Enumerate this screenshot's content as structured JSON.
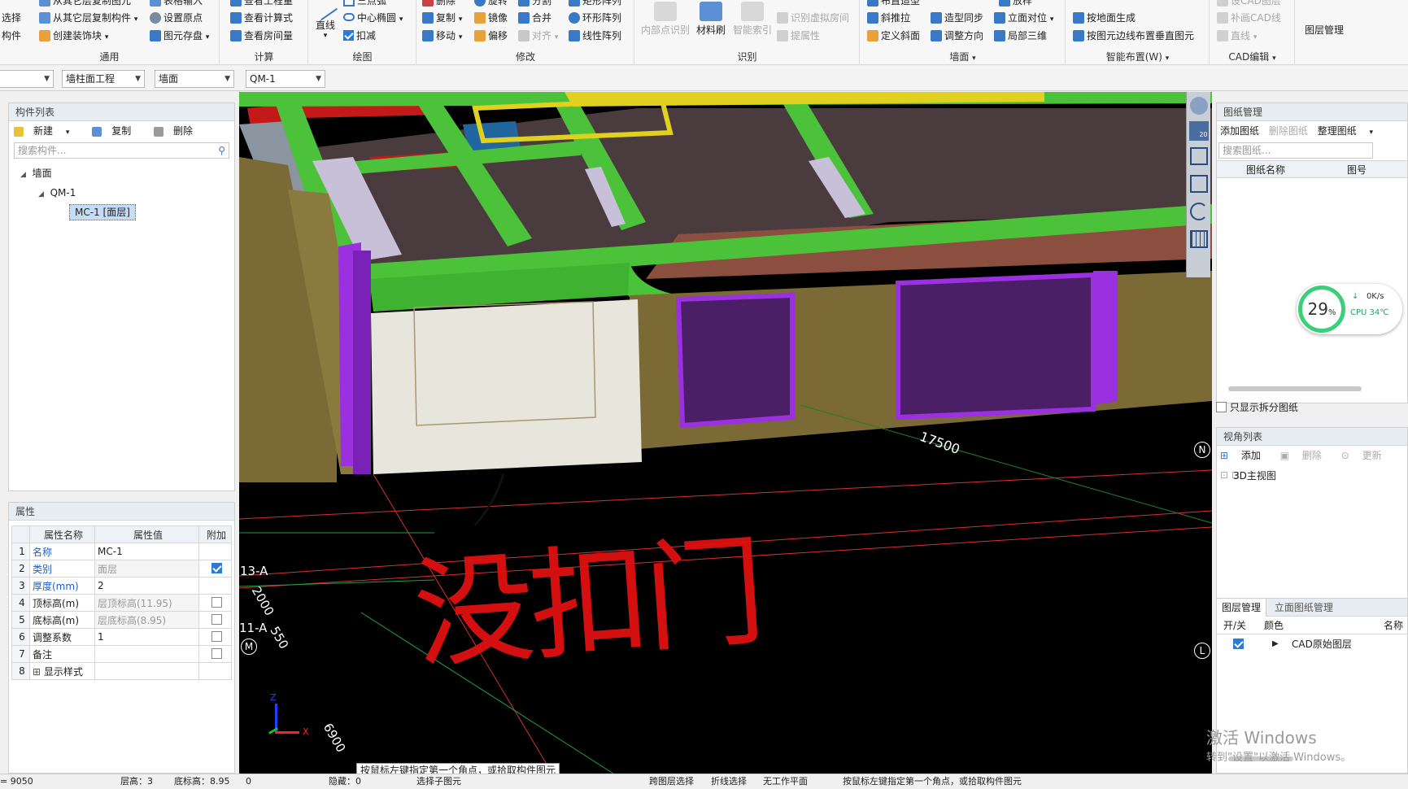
{
  "ribbon": {
    "general": {
      "title": "通用",
      "items": [
        "从其它层复制构件",
        "创建装饰块",
        "设置原点",
        "图元存盘",
        "从其它层复制图元",
        "表格输入"
      ],
      "left_items": [
        "选择",
        "构件"
      ]
    },
    "calc": {
      "title": "计算",
      "items": [
        "查看工程量",
        "查看计算式",
        "查看房间量"
      ]
    },
    "draw": {
      "title": "绘图",
      "items": [
        "直线",
        "中心椭圆",
        "扣减",
        "三点弧"
      ]
    },
    "modify": {
      "title": "修改",
      "items": [
        "删除",
        "旋转",
        "分割",
        "矩形阵列",
        "复制",
        "镜像",
        "合并",
        "环形阵列",
        "移动",
        "偏移",
        "对齐",
        "线性阵列"
      ]
    },
    "identify": {
      "title": "识别",
      "items": [
        "内部点识别",
        "材料刷",
        "智能索引",
        "识别虚拟房间",
        "提属性"
      ]
    },
    "wall": {
      "title": "墙面",
      "items": [
        "斜推拉",
        "造型同步",
        "立面对位",
        "定义斜面",
        "调整方向",
        "局部三维",
        "布置造型",
        "放样"
      ]
    },
    "smart": {
      "title": "智能布置(W)",
      "items": [
        "按地面生成",
        "按图元边线布置垂直图元"
      ]
    },
    "cadedit": {
      "title": "CAD编辑",
      "items": [
        "补画CAD线",
        "直线",
        "设CAD图层"
      ]
    },
    "layer": {
      "title": "图层管理"
    }
  },
  "selectbar": {
    "combo0": "",
    "combo1": "墙柱面工程",
    "combo2": "墙面",
    "combo3": "QM-1"
  },
  "component_list": {
    "title": "构件列表",
    "new_label": "新建",
    "copy_label": "复制",
    "delete_label": "删除",
    "search_placeholder": "搜索构件...",
    "tree": {
      "root": "墙面",
      "child": "QM-1",
      "leaf": "MC-1 [面层]"
    }
  },
  "properties": {
    "title": "属性",
    "headers": [
      "属性名称",
      "属性值",
      "附加"
    ],
    "rows": [
      {
        "no": "1",
        "name": "名称",
        "value": "MC-1",
        "blue": true,
        "gray": false,
        "check": "none"
      },
      {
        "no": "2",
        "name": "类别",
        "value": "面层",
        "blue": true,
        "gray": true,
        "check": "on"
      },
      {
        "no": "3",
        "name": "厚度(mm)",
        "value": "2",
        "blue": true,
        "gray": false,
        "check": "none"
      },
      {
        "no": "4",
        "name": "顶标高(m)",
        "value": "层顶标高(11.95)",
        "blue": false,
        "gray": true,
        "check": "off"
      },
      {
        "no": "5",
        "name": "底标高(m)",
        "value": "层底标高(8.95)",
        "blue": false,
        "gray": true,
        "check": "off"
      },
      {
        "no": "6",
        "name": "调整系数",
        "value": "1",
        "blue": false,
        "gray": false,
        "check": "off"
      },
      {
        "no": "7",
        "name": "备注",
        "value": "",
        "blue": false,
        "gray": false,
        "check": "off"
      },
      {
        "no": "8",
        "name": "显示样式",
        "value": "",
        "blue": false,
        "gray": false,
        "check": "none"
      }
    ]
  },
  "viewport": {
    "dimension_17500": "17500",
    "axis_13a": "13-A",
    "axis_11a": "11-A",
    "axis_m": "M",
    "dim_2000": "2000",
    "dim_550": "550",
    "dim_6900": "6900",
    "compass_n": "N",
    "compass_l": "L",
    "handwriting": "没扣门",
    "tooltip": "按鼠标左键指定第一个角点，或拾取构件图元",
    "view_20": "20",
    "axis_z": "Z",
    "axis_x": "X"
  },
  "drawing_mgmt": {
    "title": "图纸管理",
    "add_label": "添加图纸",
    "delete_label": "删除图纸",
    "organize_label": "整理图纸",
    "search_placeholder": "搜索图纸...",
    "col_name": "图纸名称",
    "col_no": "图号",
    "split_checkbox": "只显示拆分图纸"
  },
  "cpu_widget": {
    "percent": "29",
    "percent_unit": "%",
    "speed": "0K/s",
    "cpu_temp": "CPU 34℃"
  },
  "view_list": {
    "title": "视角列表",
    "add": "添加",
    "delete": "删除",
    "update": "更新",
    "item": "3D主视图"
  },
  "layer_mgmt": {
    "tab1": "图层管理",
    "tab2": "立面图纸管理",
    "col_onoff": "开/关",
    "col_color": "颜色",
    "col_name": "名称",
    "row_name": "CAD原始图层"
  },
  "watermark": {
    "line1": "激活 Windows",
    "line2": "转到\"设置\"以激活 Windows。"
  },
  "statusbar": {
    "coord": "= 9050",
    "floor": "层高：3",
    "base": "底标高：8.95",
    "zero": "0",
    "hidden": "隐藏：0",
    "select": "选择子图元",
    "cross": "跨图层选择",
    "polyline": "折线选择",
    "workplane": "无工作平面",
    "hint": "按鼠标左键指定第一个角点，或拾取构件图元"
  },
  "colors": {
    "green": "#4cc23a",
    "purple": "#9b30e0",
    "olive": "#7b6a35",
    "darkslab": "#4a3c3e",
    "brownslab": "#8b4f3f",
    "red": "#c31919",
    "door": "#e8e6dc"
  }
}
